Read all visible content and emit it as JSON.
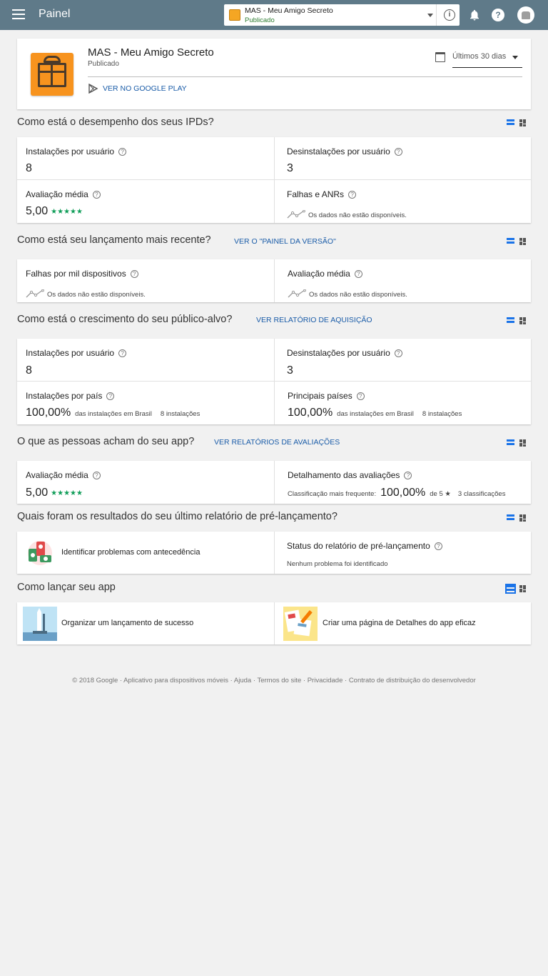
{
  "header": {
    "title": "Painel",
    "app_select": {
      "name": "MAS - Meu Amigo Secreto",
      "status": "Publicado"
    },
    "help_glyph": "?"
  },
  "app_card": {
    "name": "MAS - Meu Amigo Secreto",
    "status": "Publicado",
    "play_link": "VER NO GOOGLE PLAY",
    "period": "Últimos 30 dias"
  },
  "ipd": {
    "title": "Como está o desempenho dos seus IPDs?",
    "installs_label": "Instalações por usuário",
    "installs_value": "8",
    "uninstalls_label": "Desinstalações por usuário",
    "uninstalls_value": "3",
    "rating_label": "Avaliação média",
    "rating_value": "5,00",
    "rating_stars": "★★★★★",
    "crashes_label": "Falhas e ANRs",
    "crashes_nodata": "Os dados não estão disponíveis."
  },
  "release": {
    "title": "Como está seu lançamento mais recente?",
    "link": "VER O \"PAINEL DA VERSÃO\"",
    "crashes_label": "Falhas por mil dispositivos",
    "crashes_nodata": "Os dados não estão disponíveis.",
    "rating_label": "Avaliação média",
    "rating_nodata": "Os dados não estão disponíveis."
  },
  "audience": {
    "title": "Como está o crescimento do seu público-alvo?",
    "link": "VER RELATÓRIO DE AQUISIÇÃO",
    "installs_label": "Instalações por usuário",
    "installs_value": "8",
    "uninstalls_label": "Desinstalações por usuário",
    "uninstalls_value": "3",
    "country_label": "Instalações por país",
    "country_value": "100,00%",
    "country_note": "das instalações em Brasil",
    "country_count": "8 instalações",
    "top_label": "Principais países",
    "top_value": "100,00%",
    "top_note": "das instalações em Brasil",
    "top_count": "8 instalações"
  },
  "reviews": {
    "title": "O que as pessoas acham do seu app?",
    "link": "VER RELATÓRIOS DE AVALIAÇÕES",
    "rating_label": "Avaliação média",
    "rating_value": "5,00",
    "rating_stars": "★★★★★",
    "breakdown_label": "Detalhamento das avaliações",
    "freq_label": "Classificação mais frequente:",
    "freq_value": "100,00%",
    "freq_of": "de 5 ★",
    "freq_count": "3 classificações"
  },
  "prelaunch": {
    "title": "Quais foram os resultados do seu último relatório de pré-lançamento?",
    "identify_label": "Identificar problemas com antecedência",
    "status_label": "Status do relatório de pré-lançamento",
    "status_value": "Nenhum problema foi identificado"
  },
  "launch": {
    "title": "Como lançar seu app",
    "organize_label": "Organizar um lançamento de sucesso",
    "details_label": "Criar uma página de Detalhes do app eficaz"
  },
  "footer": {
    "copyright": "© 2018 Google",
    "links": [
      "Aplicativo para dispositivos móveis",
      "Ajuda",
      "Termos do site",
      "Privacidade",
      "Contrato de distribuição do desenvolvedor"
    ]
  }
}
